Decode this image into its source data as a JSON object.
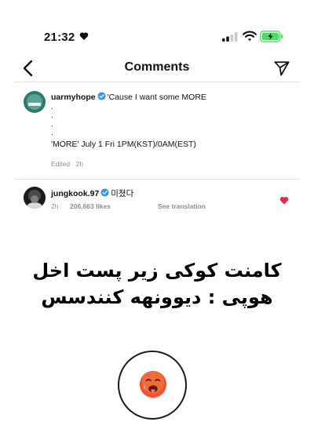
{
  "status_bar": {
    "time": "21:32"
  },
  "header": {
    "title": "Comments"
  },
  "comment1": {
    "username": "uarmyhope",
    "text": "'Cause I want some MORE",
    "dots": [
      ".",
      ".",
      ".",
      "."
    ],
    "line2": "'MORE' July 1 Fri 1PM(KST)/0AM(EST)",
    "meta": "Edited · 2h"
  },
  "comment2": {
    "username": "jungkook.97",
    "text": "미쳤다",
    "time": "2h",
    "likes": "206,663 likes",
    "translation": "See translation"
  },
  "caption": {
    "line1": "کامنت کوکی زیر پست اخل",
    "line2": "هوپی : دیوونهه کنندسس"
  },
  "colors": {
    "verified": "#3897f0",
    "heart": "#ed2847",
    "battery": "#4cd964"
  },
  "icons": [
    "heart-icon",
    "signal-icon",
    "wifi-icon",
    "battery-icon",
    "back-arrow-icon",
    "send-icon",
    "verified-icon",
    "like-heart-icon",
    "hot-face-emoji"
  ]
}
